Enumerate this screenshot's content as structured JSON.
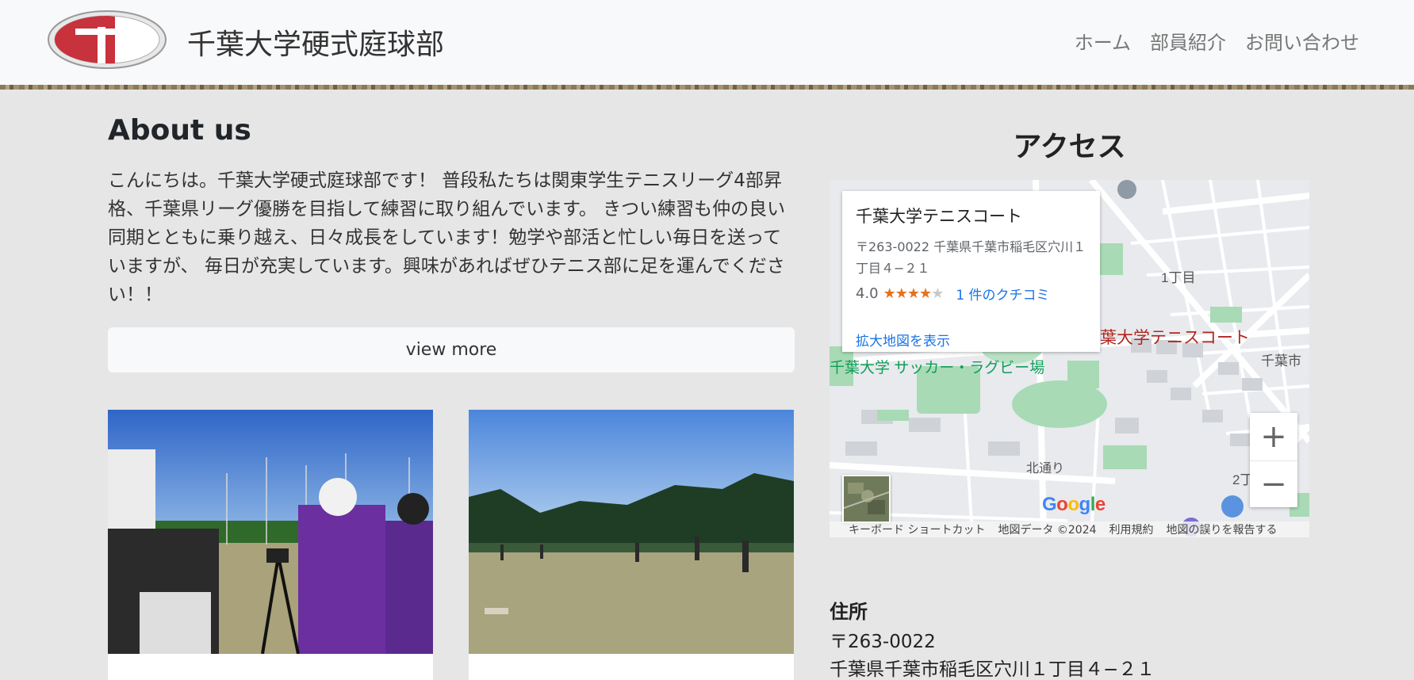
{
  "navbar": {
    "brand": "千葉大学硬式庭球部",
    "links": [
      "ホーム",
      "部員紹介",
      "お問い合わせ"
    ]
  },
  "about": {
    "title": "About us",
    "text": "こんにちは。千葉大学硬式庭球部です！ 普段私たちは関東学生テニスリーグ4部昇格、千葉県リーグ優勝を目指して練習に取り組んでいます。 きつい練習も仲の良い同期とともに乗り越え、日々成長をしています！勉学や部活と忙しい毎日を送っていますが、 毎日が充実しています。興味があればぜひテニス部に足を運んでください！！",
    "button": "view more"
  },
  "access": {
    "title": "アクセス",
    "map": {
      "place_name": "千葉大学テニスコート",
      "address": "〒263-0022 千葉県千葉市稲毛区穴川１丁目４−２１",
      "rating": "4.0",
      "stars": 4,
      "reviews": "1 件のクチコミ",
      "larger_map": "拡大地図を表示",
      "labels": {
        "marker": "千葉大学テニスコート",
        "soccer": "千葉大学 サッカー・ラグビー場",
        "chome1": "1丁目",
        "chome2": "2丁",
        "kitadori": "北通り",
        "chibashi": "千葉市"
      },
      "zoom_in": "+",
      "zoom_out": "−",
      "attribution": [
        "キーボード ショートカット",
        "地図データ ©2024",
        "利用規約",
        "地図の誤りを報告する"
      ],
      "google": "Google"
    },
    "address_label": "住所",
    "postal": "〒263-0022",
    "address": "千葉県千葉市稲毛区穴川１丁目４−２１"
  },
  "colors": {
    "logo_red": "#c8323c",
    "link_blue": "#1a73e8",
    "marker_red": "#b3261e",
    "park_green": "#9fd5a8"
  }
}
